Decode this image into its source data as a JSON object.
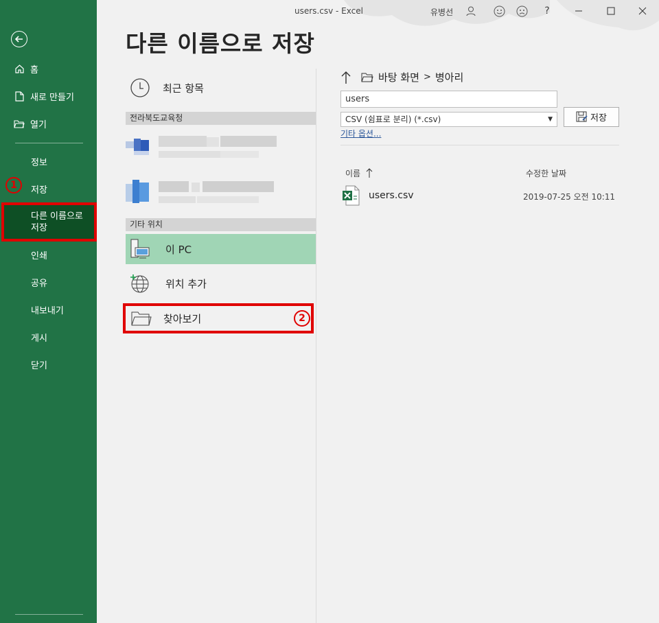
{
  "window": {
    "doc_title": "users.csv  -  Excel",
    "user_name": "유병선",
    "help": "?"
  },
  "nav": {
    "home": "홈",
    "new": "새로 만들기",
    "open": "열기",
    "info": "정보",
    "save": "저장",
    "save_as_line1": "다른 이름으로",
    "save_as_line2": "저장",
    "print": "인쇄",
    "share": "공유",
    "export": "내보내기",
    "publish": "게시",
    "close": "닫기"
  },
  "badges": {
    "one": "1",
    "two": "2"
  },
  "page_title": "다른 이름으로 저장",
  "locations": {
    "recent": "최근 항목",
    "org_group": "전라북도교육청",
    "other_group": "기타 위치",
    "this_pc": "이 PC",
    "add_place": "위치 추가",
    "browse": "찾아보기"
  },
  "save_panel": {
    "path_part1": "바탕 화면",
    "path_sep": ">",
    "path_part2": "병아리",
    "filename": "users",
    "filetype": "CSV (쉼표로 분리) (*.csv)",
    "save_button": "저장",
    "more_options": "기타 옵션...",
    "col_name": "이름",
    "col_modified": "수정한 날짜",
    "files": [
      {
        "name": "users.csv",
        "modified": "2019-07-25 오전 10:11"
      }
    ]
  },
  "colors": {
    "nav_bg": "#217346",
    "nav_active": "#0e4f25",
    "highlight_red": "#e00000",
    "this_pc_bg": "#a0d5b5"
  }
}
